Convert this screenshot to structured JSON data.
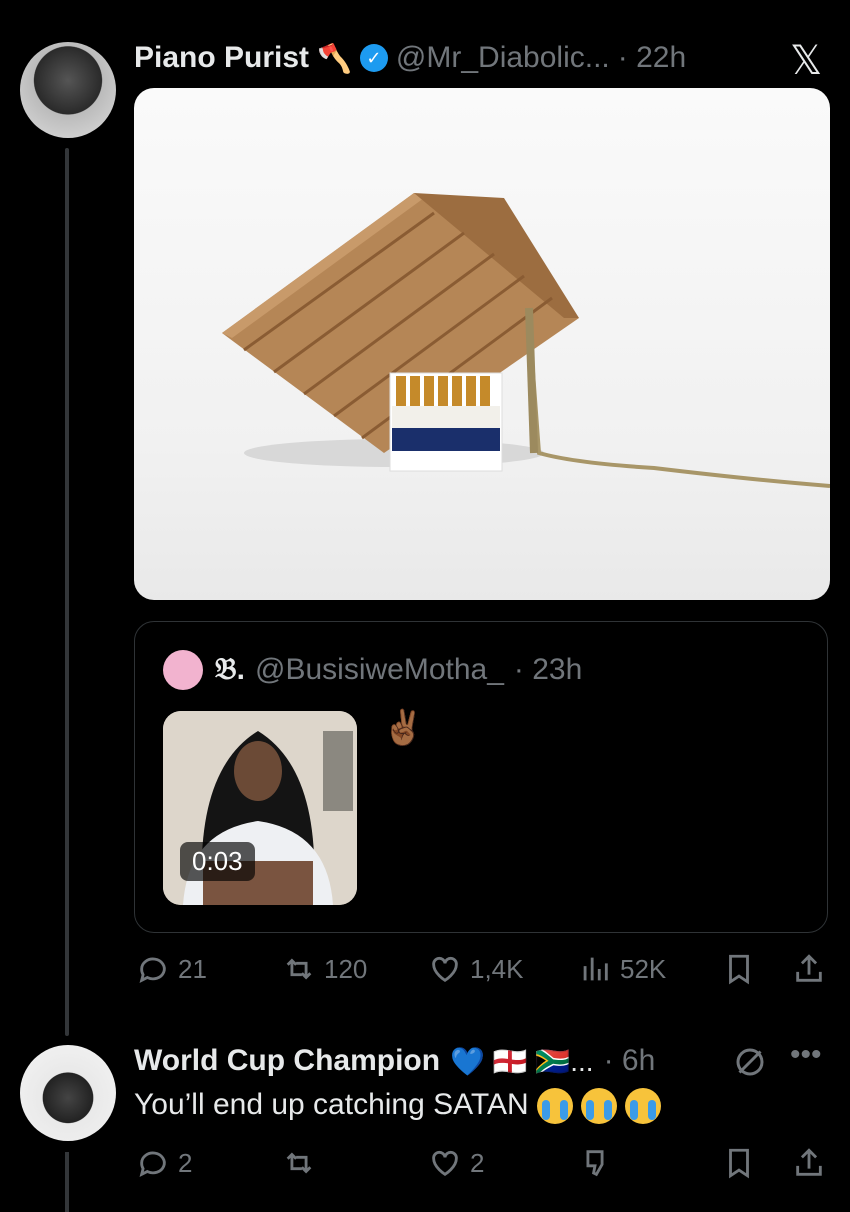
{
  "colors": {
    "background": "#000000",
    "text": "#e7e9ea",
    "muted": "#71767b",
    "accent": "#1d9bf0",
    "border": "#2f3336"
  },
  "tweet": {
    "author_name": "Piano Purist",
    "author_emoji": "🪓",
    "handle": "@Mr_Diabolic...",
    "time": "· 22h",
    "verified_icon": "verified-badge-icon",
    "x_logo": "𝕏",
    "media_description_icon": "image",
    "quote": {
      "avatar_icon": "avatar-placeholder",
      "name": "𝔅.",
      "handle": "@BusisiweMotha_",
      "time": "· 23h",
      "text": "✌🏾",
      "video_duration": "0:03"
    },
    "stats": {
      "replies": "21",
      "reposts": "120",
      "likes": "1,4K",
      "views": "52K"
    }
  },
  "reply": {
    "author_name": "World Cup Champion",
    "author_flags": "💙 🏴󠁧󠁢󠁥󠁮󠁧󠁿 🇿🇦...",
    "time": "· 6h",
    "text": "You’ll end up catching SATAN",
    "stats": {
      "replies": "2",
      "likes": "2"
    }
  }
}
